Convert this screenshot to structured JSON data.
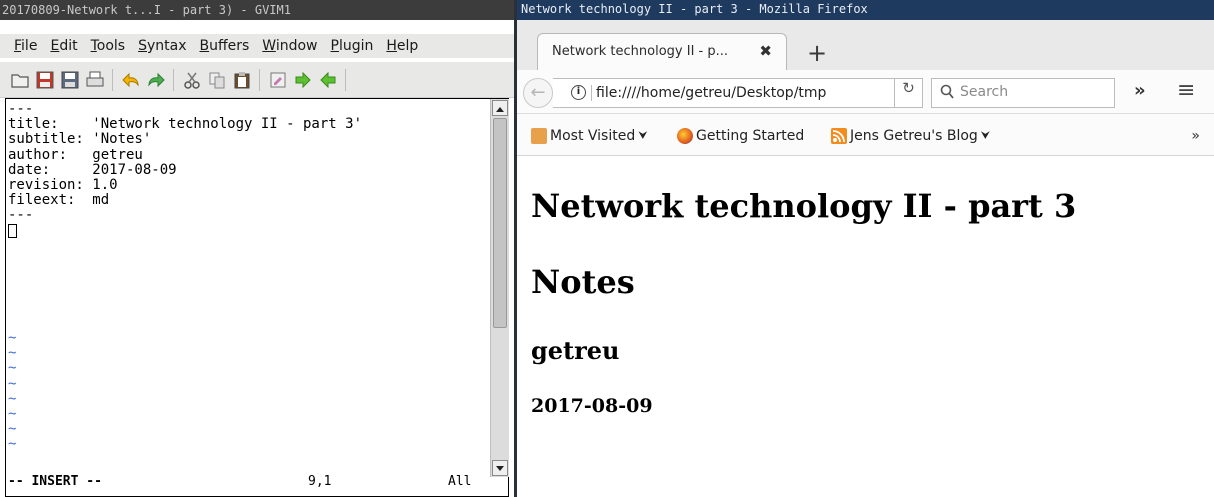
{
  "gvim": {
    "title": "20170809-Network t...I - part 3) - GVIM1",
    "menu": [
      "File",
      "Edit",
      "Tools",
      "Syntax",
      "Buffers",
      "Window",
      "Plugin",
      "Help"
    ],
    "lines": [
      "---",
      "title:    'Network technology II - part 3'",
      "subtitle: 'Notes'",
      "author:   getreu",
      "date:     2017-08-09",
      "revision: 1.0",
      "fileext:  md",
      "---"
    ],
    "tildes": [
      "~",
      "~",
      "~",
      "~",
      "~",
      "~",
      "~",
      "~"
    ],
    "status": {
      "mode": "-- INSERT --",
      "position": "9,1",
      "scroll": "All"
    }
  },
  "firefox": {
    "window_title": "Network technology II - part 3 - Mozilla Firefox",
    "tab_label": "Network technology II - p...",
    "tab_close": "✖",
    "new_tab": "+",
    "url": "file:////home/getreu/Desktop/tmp",
    "search_placeholder": "Search",
    "bookmarks": [
      {
        "label": "Most Visited",
        "icon": "most-visited-icon"
      },
      {
        "label": "Getting Started",
        "icon": "firefox-icon"
      },
      {
        "label": "Jens Getreu's Blog",
        "icon": "rss-icon"
      }
    ],
    "content": {
      "title": "Network technology II - part 3",
      "subtitle": "Notes",
      "author": "getreu",
      "date": "2017-08-09"
    }
  },
  "colors": {
    "gvim_titlebar": "#3c3c3c",
    "firefox_titlebar": "#1f3a5f",
    "tilde": "#3f6fd6",
    "rss": "#f28c1c"
  }
}
